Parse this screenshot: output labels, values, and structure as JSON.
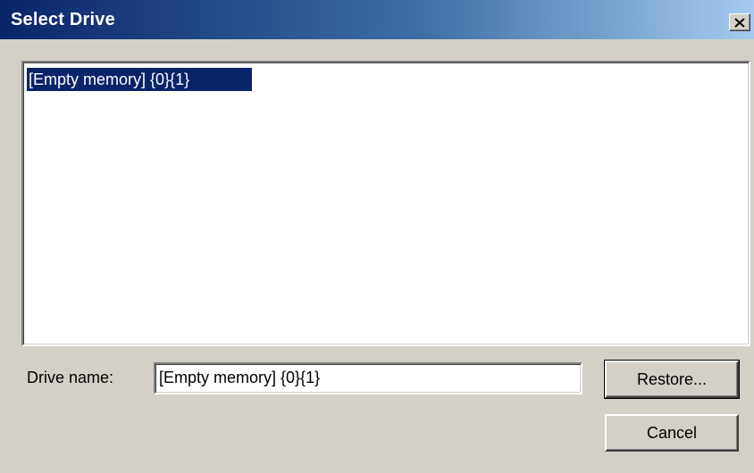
{
  "window": {
    "title": "Select Drive",
    "close_icon": "close-icon"
  },
  "drive_list": {
    "items": [
      {
        "label": "[Empty memory] {0}{1}",
        "selected": true
      }
    ]
  },
  "drive_name": {
    "label": "Drive name:",
    "value": "[Empty memory] {0}{1}"
  },
  "buttons": {
    "restore": "Restore...",
    "cancel": "Cancel"
  },
  "colors": {
    "titlebar_start": "#0a246a",
    "titlebar_end": "#a6caf0",
    "selection": "#0a246a",
    "face": "#d4d0c8"
  }
}
